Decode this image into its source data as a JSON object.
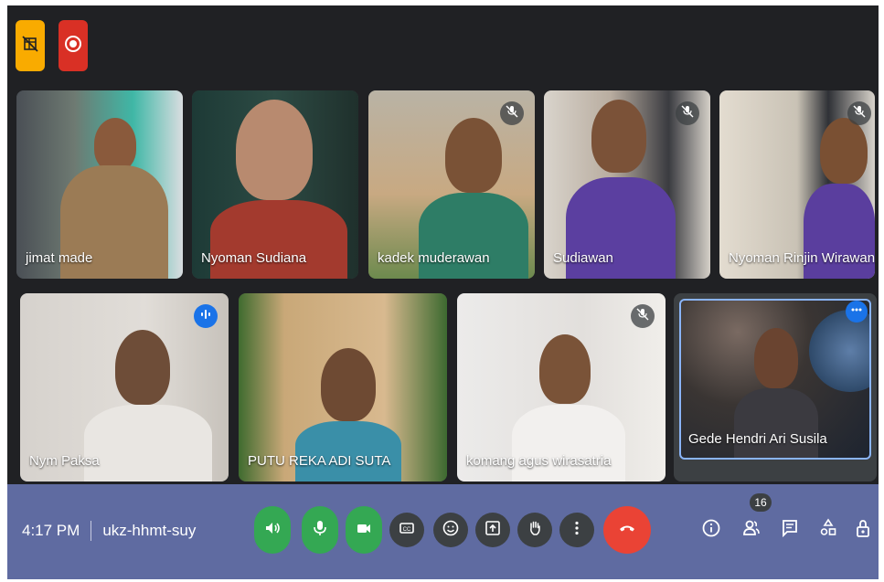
{
  "top_controls": {
    "left_icon": "no-grid-icon",
    "right_icon": "record-icon",
    "left_color": "#f9ab00",
    "right_color": "#d93025"
  },
  "participants": [
    {
      "name": "jimat made",
      "muted": false
    },
    {
      "name": "Nyoman Sudiana",
      "muted": false
    },
    {
      "name": "kadek muderawan",
      "muted": true
    },
    {
      "name": "Sudiawan",
      "muted": true
    },
    {
      "name": "Nyoman Rinjin Wirawan",
      "muted": true
    },
    {
      "name": "Nym Paksa",
      "speaking": true
    },
    {
      "name": "PUTU REKA ADI SUTA",
      "muted": false
    },
    {
      "name": "komang agus wirasatria",
      "muted": true
    },
    {
      "name": "Gede Hendri Ari Susila",
      "self": true,
      "more_icon": "more-horiz-icon"
    }
  ],
  "footer": {
    "time": "4:17 PM",
    "meeting_code": "ukz-hhmt-suy",
    "people_count": "16",
    "controls": [
      {
        "icon": "volume-icon",
        "color": "#34a853"
      },
      {
        "icon": "mic-icon",
        "color": "#34a853"
      },
      {
        "icon": "camera-icon",
        "color": "#34a853"
      },
      {
        "icon": "captions-icon",
        "color": "#3c4043"
      },
      {
        "icon": "emoji-icon",
        "color": "#3c4043"
      },
      {
        "icon": "present-icon",
        "color": "#3c4043"
      },
      {
        "icon": "raise-hand-icon",
        "color": "#3c4043"
      },
      {
        "icon": "more-vert-icon",
        "color": "#3c4043"
      },
      {
        "icon": "end-call-icon",
        "color": "#ea4335"
      }
    ],
    "right_icons": [
      "info-icon",
      "people-icon",
      "chat-icon",
      "activities-icon",
      "host-controls-icon"
    ]
  }
}
